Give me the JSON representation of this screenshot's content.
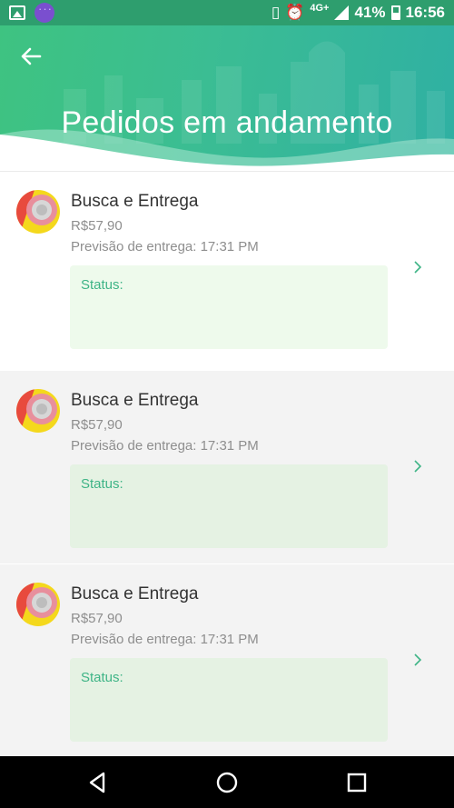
{
  "status_bar": {
    "network": "4G+",
    "battery": "41%",
    "time": "16:56",
    "icons": [
      "photo-icon",
      "chat-icon",
      "vibrate-icon",
      "alarm-icon",
      "signal-icon",
      "battery-icon"
    ]
  },
  "header": {
    "title": "Pedidos em andamento",
    "back_icon": "arrow-left-icon"
  },
  "orders": [
    {
      "title": "Busca e Entrega",
      "price": "R$57,90",
      "eta": "Previsão de entrega: 17:31 PM",
      "status_label": "Status:"
    },
    {
      "title": "Busca e Entrega",
      "price": "R$57,90",
      "eta": "Previsão de entrega: 17:31 PM",
      "status_label": "Status:"
    },
    {
      "title": "Busca e Entrega",
      "price": "R$57,90",
      "eta": "Previsão de entrega: 17:31 PM",
      "status_label": "Status:"
    }
  ],
  "colors": {
    "header_start": "#3ec381",
    "header_end": "#2fb0a3",
    "accent": "#3eb486",
    "status_box_light": "#eefaec",
    "status_box": "#e5f2e3"
  },
  "nav": {
    "icons": [
      "back-triangle-icon",
      "home-circle-icon",
      "recents-square-icon"
    ]
  }
}
